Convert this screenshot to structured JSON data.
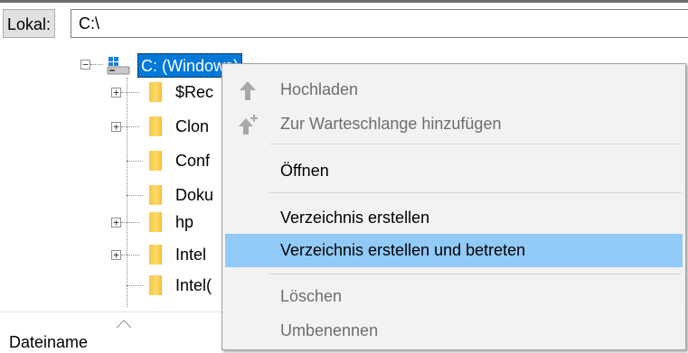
{
  "path_bar": {
    "label": "Lokal:",
    "value": "C:\\"
  },
  "tree": {
    "drive": {
      "label": "C: (Windows)",
      "expander": "−"
    },
    "items": [
      {
        "label": "$Rec",
        "expander": "+"
      },
      {
        "label": "Clon",
        "expander": "+"
      },
      {
        "label": "Conf",
        "expander": ""
      },
      {
        "label": "Doku",
        "expander": ""
      },
      {
        "label": "hp",
        "expander": "+"
      },
      {
        "label": "Intel",
        "expander": "+"
      },
      {
        "label": "Intel(",
        "expander": ""
      }
    ]
  },
  "list_header": {
    "column_filename": "Dateiname"
  },
  "context_menu": {
    "upload": "Hochladen",
    "add_to_queue": "Zur Warteschlange hinzufügen",
    "open": "Öffnen",
    "create_dir": "Verzeichnis erstellen",
    "create_dir_enter": "Verzeichnis erstellen und betreten",
    "delete": "Löschen",
    "rename": "Umbenennen"
  },
  "colors": {
    "selection": "#0078d7",
    "menu_highlight": "#91c9f7",
    "disabled_text": "#6d6d6d",
    "folder": "#ffd966"
  }
}
